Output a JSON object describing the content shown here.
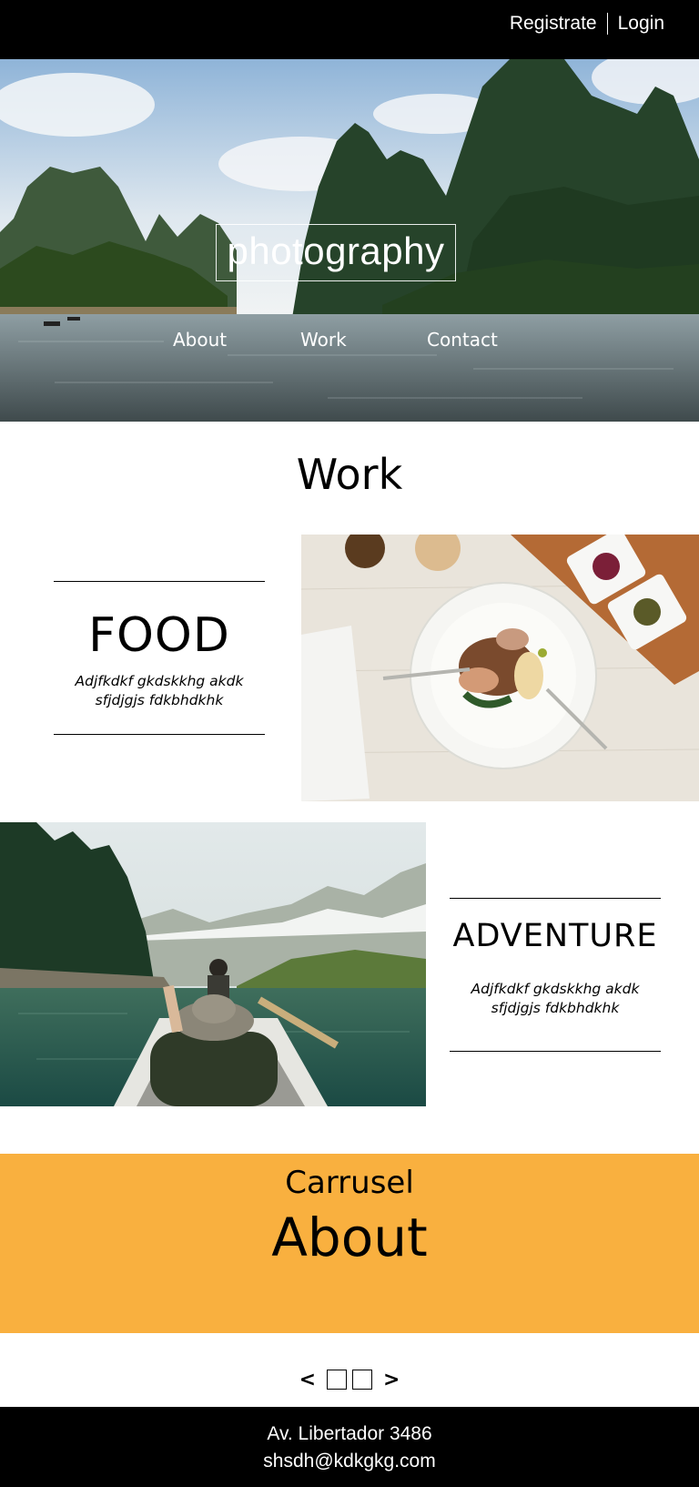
{
  "header": {
    "register_label": "Registrate",
    "login_label": "Login"
  },
  "hero": {
    "brand": "photography",
    "nav": [
      {
        "label": "About"
      },
      {
        "label": "Work"
      },
      {
        "label": "Contact"
      }
    ]
  },
  "work": {
    "title": "Work",
    "categories": [
      {
        "title": "FOOD",
        "description": "Adjfkdkf gkdskkhg akdk sfjdjgjs fdkbhdkhk"
      },
      {
        "title": "ADVENTURE",
        "description": "Adjfkdkf gkdskkhg akdk sfjdjgjs fdkbhdkhk"
      }
    ]
  },
  "band": {
    "subtitle": "Carrusel",
    "title": "About",
    "color": "#f9b03f"
  },
  "carousel": {
    "prev": "<",
    "next": ">"
  },
  "footer": {
    "address": "Av. Libertador 3486",
    "email": "shsdh@kdkgkg.com"
  }
}
